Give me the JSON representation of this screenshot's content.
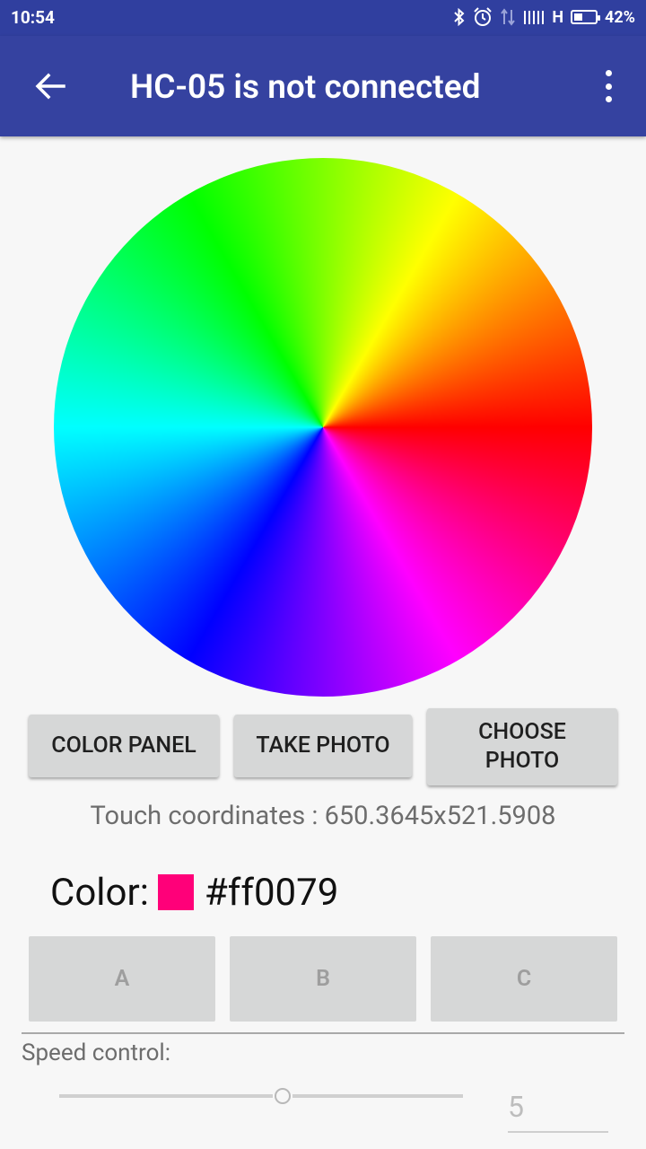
{
  "status_bar": {
    "time": "10:54",
    "network": "H",
    "battery_percent": "42%",
    "battery_level": 0.42
  },
  "app_bar": {
    "title": "HC-05 is not connected"
  },
  "color_wheel": {
    "hue_order_clockwise_from_right": [
      "#ff0000",
      "#ff00ff",
      "#0000ff",
      "#00ffff",
      "#00ff00",
      "#ffff00"
    ]
  },
  "buttons": {
    "color_panel": "COLOR PANEL",
    "take_photo": "TAKE PHOTO",
    "choose_photo": "CHOOSE\nPHOTO"
  },
  "touch_coordinates": "Touch coordinates : 650.3645x521.5908",
  "color": {
    "label": "Color:",
    "hex": "#ff0079",
    "swatch_color": "#ff0079"
  },
  "mode_buttons": [
    "A",
    "B",
    "C"
  ],
  "speed": {
    "label": "Speed control:",
    "value": "5",
    "slider_fraction": 0.55
  },
  "colors": {
    "app_bar": "#3542a0",
    "status_bar": "#303f9f",
    "button_bg": "#d6d7d7"
  }
}
